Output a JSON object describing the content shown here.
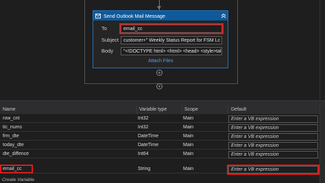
{
  "activity": {
    "title": "Send Outlook Mail Message",
    "fields": {
      "to_label": "To",
      "to_value": "email_cc",
      "subject_label": "Subject",
      "subject_value": "customer+\" Weekly Status Report for FSM Lc",
      "body_label": "Body",
      "body_value": "\"<!DOCTYPE html> <html> <head> <style>tal"
    },
    "attach_label": "Attach Files"
  },
  "variables": {
    "columns": [
      "Name",
      "Variable type",
      "Scope",
      "Default"
    ],
    "rows": [
      {
        "name": "row_cnt",
        "type": "Int32",
        "scope": "Main",
        "default": "Enter a VB expression"
      },
      {
        "name": "tic_nums",
        "type": "Int32",
        "scope": "Main",
        "default": "Enter a VB expression"
      },
      {
        "name": "frm_dte",
        "type": "DateTime",
        "scope": "Main",
        "default": "Enter a VB expression"
      },
      {
        "name": "today_dte",
        "type": "DateTime",
        "scope": "Main",
        "default": "Enter a VB expression"
      },
      {
        "name": "dte_diffence",
        "type": "Int64",
        "scope": "Main",
        "default": "Enter a VB expression"
      },
      {
        "name": "email_cc",
        "type": "String",
        "scope": "Main",
        "default": "Enter a VB expression"
      }
    ],
    "create_label": "Create Variable"
  },
  "colors": {
    "header_blue": "#0e5a9c",
    "highlight_red": "#e01b1b",
    "link_blue": "#5a9ee0"
  }
}
